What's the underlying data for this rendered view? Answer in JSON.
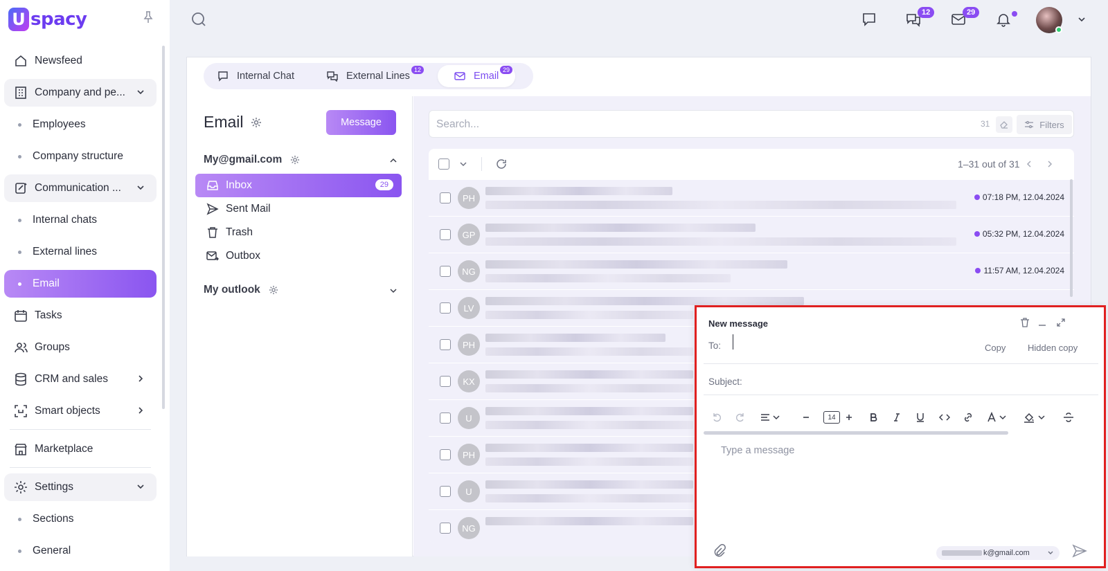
{
  "app": {
    "logo_letter": "U",
    "logo_text": "spacy"
  },
  "sidebar": {
    "items": [
      {
        "label": "Newsfeed"
      },
      {
        "label": "Company and pe..."
      },
      {
        "label": "Employees"
      },
      {
        "label": "Company structure"
      },
      {
        "label": "Communication ..."
      },
      {
        "label": "Internal chats"
      },
      {
        "label": "External lines"
      },
      {
        "label": "Email"
      },
      {
        "label": "Tasks"
      },
      {
        "label": "Groups"
      },
      {
        "label": "CRM and sales"
      },
      {
        "label": "Smart objects"
      },
      {
        "label": "Marketplace"
      },
      {
        "label": "Settings"
      },
      {
        "label": "Sections"
      },
      {
        "label": "General"
      }
    ]
  },
  "topbar": {
    "chats_badge": "12",
    "mail_badge": "29"
  },
  "tabs": [
    {
      "label": "Internal Chat"
    },
    {
      "label": "External Lines",
      "badge": "12"
    },
    {
      "label": "Email",
      "badge": "29"
    }
  ],
  "email_panel": {
    "title": "Email",
    "message_button": "Message",
    "accounts": [
      {
        "name": "My@gmail.com"
      },
      {
        "name": "My outlook"
      }
    ],
    "folders": [
      {
        "label": "Inbox",
        "count": "29"
      },
      {
        "label": "Sent Mail"
      },
      {
        "label": "Trash"
      },
      {
        "label": "Outbox"
      }
    ]
  },
  "search": {
    "placeholder": "Search...",
    "count": "31",
    "filters_label": "Filters"
  },
  "list": {
    "range": "1–31 out of 31",
    "rows": [
      {
        "initials": "PH",
        "date": "07:18 PM, 12.04.2024",
        "unread": true
      },
      {
        "initials": "GP",
        "date": "05:32 PM, 12.04.2024",
        "unread": true
      },
      {
        "initials": "NG",
        "date": "11:57 AM, 12.04.2024",
        "unread": true
      },
      {
        "initials": "LV"
      },
      {
        "initials": "PH"
      },
      {
        "initials": "KX"
      },
      {
        "initials": "U"
      },
      {
        "initials": "PH"
      },
      {
        "initials": "U"
      },
      {
        "initials": "NG"
      }
    ]
  },
  "compose": {
    "title": "New message",
    "to_label": "To:",
    "copy_label": "Copy",
    "hidden_copy_label": "Hidden copy",
    "subject_label": "Subject:",
    "font_size": "14",
    "body_placeholder": "Type a message",
    "from_suffix": "k@gmail.com"
  },
  "colors": {
    "accent": "#8a55f0",
    "highlight_border": "#e02020"
  }
}
